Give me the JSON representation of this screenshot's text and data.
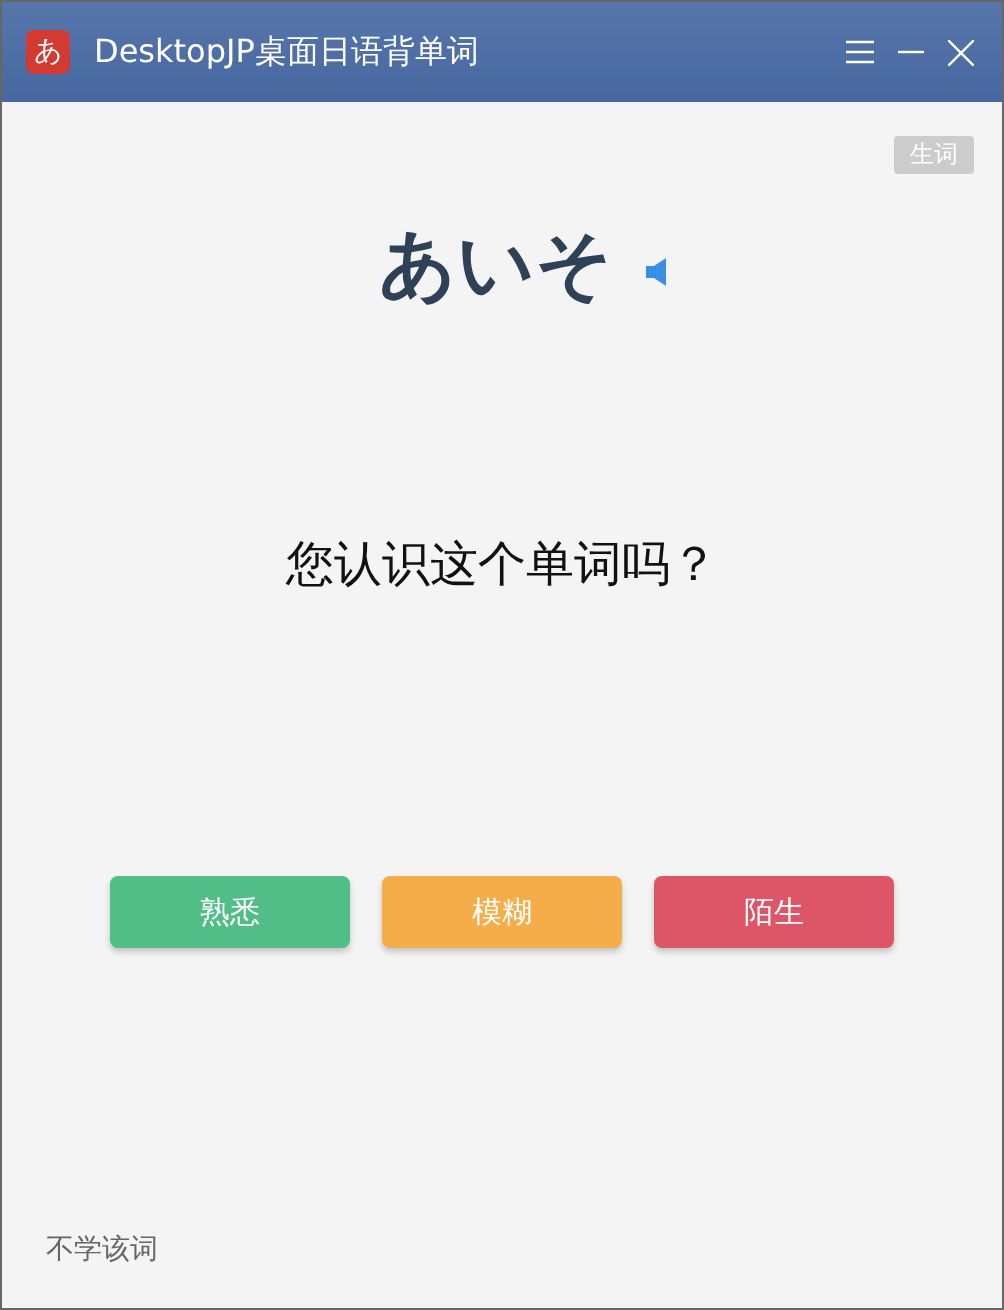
{
  "window": {
    "app_icon": "あ",
    "title": "DesktopJP桌面日语背单词"
  },
  "tag": "生词",
  "word": "あいそ",
  "question": "您认识这个单词吗？",
  "buttons": [
    {
      "label": "熟悉",
      "color": "#52be87"
    },
    {
      "label": "模糊",
      "color": "#f5ad4a"
    },
    {
      "label": "陌生",
      "color": "#dc5667"
    }
  ],
  "footer_link": "不学该词"
}
